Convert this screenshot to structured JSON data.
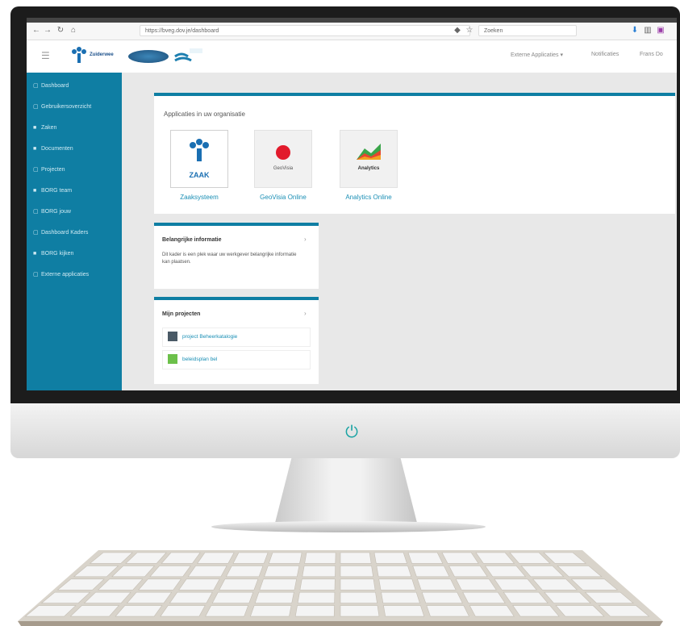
{
  "browser": {
    "url": "https://bveg.dov.je/dashboard",
    "search_placeholder": "Zoeken"
  },
  "header": {
    "logo_text": "Zuiderwee",
    "menu_external": "Externe Applicaties ▾",
    "menu_notifications": "Notificaties",
    "menu_profile": "Frans Do"
  },
  "sidebar": {
    "items": [
      {
        "icon": "▢",
        "label": "Dashboard"
      },
      {
        "icon": "▢",
        "label": "Gebruikersoverzicht"
      },
      {
        "icon": "■",
        "label": "Zaken"
      },
      {
        "icon": "■",
        "label": "Documenten"
      },
      {
        "icon": "▢",
        "label": "Projecten"
      },
      {
        "icon": "■",
        "label": "BORG team"
      },
      {
        "icon": "▢",
        "label": "BORG jouw"
      },
      {
        "icon": "▢",
        "label": "Dashboard Kaders"
      },
      {
        "icon": "■",
        "label": "BORG kijken"
      },
      {
        "icon": "▢",
        "label": "Externe applicaties"
      }
    ]
  },
  "apps_card": {
    "title": "Applicaties in uw organisatie",
    "apps": [
      {
        "label": "Zaaksysteem",
        "tile_text": "ZAAK"
      },
      {
        "label": "GeoVisia Online",
        "tile_text": "GeoVisia"
      },
      {
        "label": "Analytics Online",
        "tile_text": "Analytics"
      }
    ]
  },
  "info_card": {
    "title": "Belangrijke informatie",
    "text": "Dit kader is een plek waar uw werkgever belangrijke informatie kan plaatsen."
  },
  "projects_card": {
    "title": "Mijn projecten",
    "items": [
      "project Beheerkatalogie",
      "beleidsplan bel"
    ]
  },
  "colors": {
    "sidebar": "#0f7ea3",
    "accent": "#1a8fb5",
    "power": "#18a3a3"
  }
}
